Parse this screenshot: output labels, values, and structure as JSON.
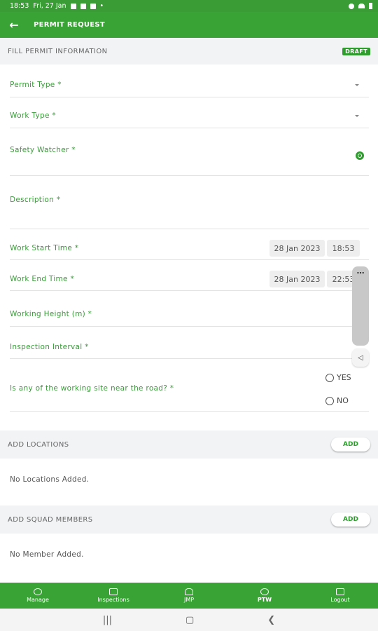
{
  "status_bar": {
    "time": "18:53",
    "date": "Fri, 27 Jan"
  },
  "app_bar": {
    "title": "PERMIT REQUEST"
  },
  "info_section": {
    "title": "FILL PERMIT INFORMATION",
    "badge": "DRAFT"
  },
  "fields": {
    "permit_type": "Permit Type *",
    "work_type": "Work Type *",
    "safety_watcher": "Safety Watcher *",
    "description": "Description *",
    "work_start": {
      "label": "Work Start Time *",
      "date": "28 Jan 2023",
      "time": "18:53"
    },
    "work_end": {
      "label": "Work End Time *",
      "date": "28 Jan 2023",
      "time": "22:53"
    },
    "working_height": "Working Height (m) *",
    "inspection_interval": "Inspection Interval *",
    "near_road": {
      "label": "Is any of the working site near the road? *",
      "yes": "YES",
      "no": "NO"
    }
  },
  "locations": {
    "title": "ADD LOCATIONS",
    "button": "ADD",
    "empty": "No Locations Added."
  },
  "squad": {
    "title": "ADD SQUAD MEMBERS",
    "button": "ADD",
    "empty": "No Member Added."
  },
  "bottom_nav": [
    "Manage",
    "Inspections",
    "JMP",
    "PTW",
    "Logout"
  ],
  "icons": {
    "back": "arrow-left-icon",
    "search": "search-icon",
    "more": "more-icon",
    "speaker": "speaker-icon",
    "dropdown": "chevron-down-icon"
  },
  "colors": {
    "primary": "#3aa336",
    "label": "#3b9a3b",
    "badge": "#2e9d2e"
  }
}
